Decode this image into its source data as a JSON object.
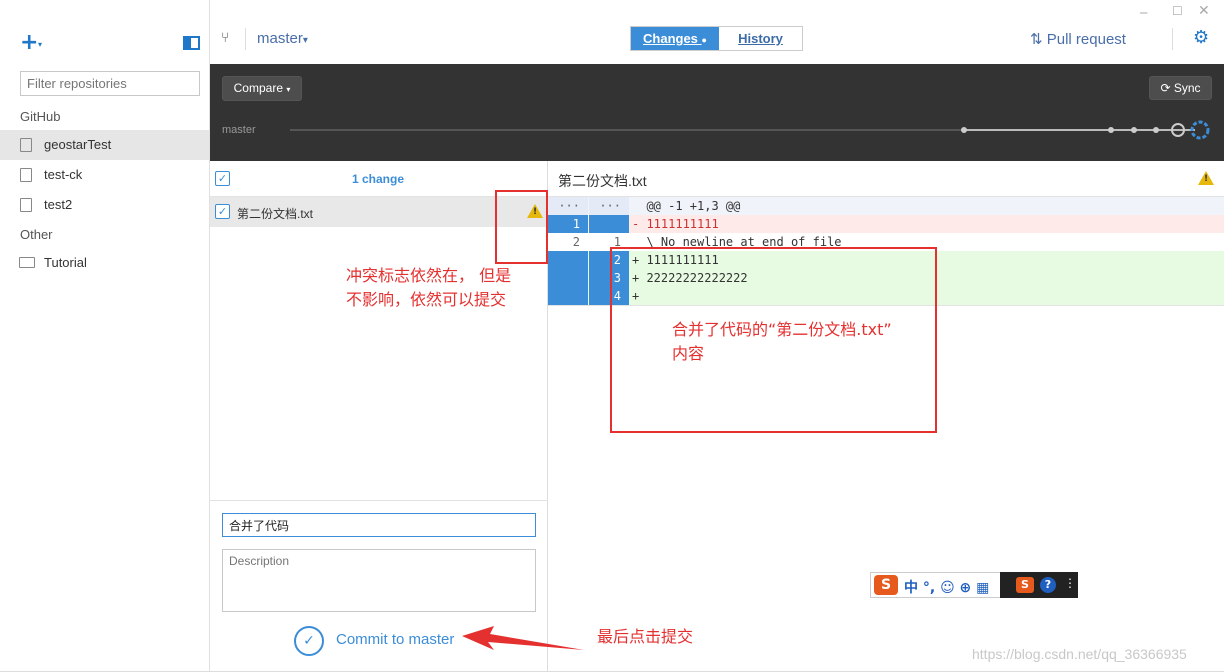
{
  "window": {
    "min_icon": "─",
    "max_icon": "☐",
    "close_icon": "✕"
  },
  "sidebar": {
    "add_icon": "+",
    "add_caret": "▾",
    "filter_placeholder": "Filter repositories",
    "groups": [
      {
        "label": "GitHub",
        "repos": [
          "geostarTest",
          "test-ck",
          "test2"
        ]
      },
      {
        "label": "Other",
        "repos": [
          "Tutorial"
        ]
      }
    ],
    "selected_repo": "geostarTest"
  },
  "header": {
    "branch_icon": "⑂",
    "branch": "master",
    "branch_caret": "▾",
    "tabs": {
      "changes": "Changes",
      "changes_dot": "●",
      "history": "History"
    },
    "pull_request": "Pull request",
    "pull_request_icon": "⇅",
    "settings_icon": "⚙"
  },
  "toolbar": {
    "compare_label": "Compare",
    "compare_caret": "▾",
    "sync_label": "Sync",
    "sync_icon": "⟳",
    "timeline_branch": "master"
  },
  "changes": {
    "count_label": "1 change",
    "check_mark": "✓",
    "files": [
      {
        "name": "第二份文档.txt",
        "warning": true
      }
    ],
    "warning_mark": "!"
  },
  "commit": {
    "summary_value": "合并了代码",
    "description_placeholder": "Description",
    "button_label": "Commit to master",
    "button_icon": "✓"
  },
  "diff": {
    "file_name": "第二份文档.txt",
    "hunk_marker": "···",
    "lines": [
      {
        "kind": "hunk",
        "old": "···",
        "new": "···",
        "text": "  @@ -1 +1,3 @@"
      },
      {
        "kind": "del",
        "old": "1",
        "new": "",
        "text": "- 1111111111"
      },
      {
        "kind": "ctx",
        "old": "2",
        "new": "1",
        "text": "  \\ No newline at end of file"
      },
      {
        "kind": "add",
        "old": "",
        "new": "2",
        "text": "+ 1111111111"
      },
      {
        "kind": "add",
        "old": "",
        "new": "3",
        "text": "+ 22222222222222"
      },
      {
        "kind": "add",
        "old": "",
        "new": "4",
        "text": "+"
      }
    ]
  },
  "annotations": {
    "conflict_note_line1": "冲突标志依然在， 但是",
    "conflict_note_line2": "不影响，依然可以提交",
    "merge_note_line1": "合并了代码的“第二份文档.txt”",
    "merge_note_line2": "内容",
    "commit_note": "最后点击提交"
  },
  "ime": {
    "s_logo": "S",
    "text": "中 °, ☺ ⊕ ▦",
    "help": "?",
    "menu": "⋮"
  },
  "watermark": "https://blog.csdn.net/qq_36366935"
}
